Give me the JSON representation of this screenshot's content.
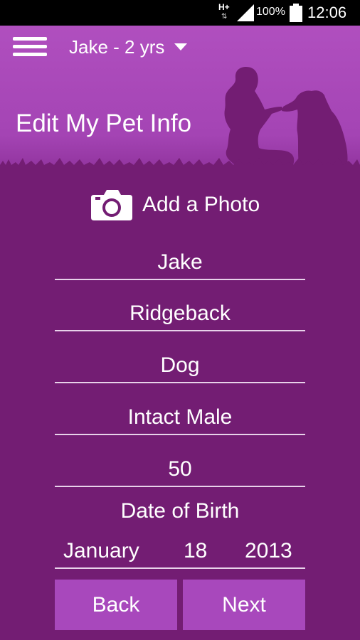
{
  "status_bar": {
    "network": "H+",
    "network_arrows": "⇅",
    "battery": "100%",
    "time": "12:06"
  },
  "header": {
    "menu_icon": "hamburger-menu-icon",
    "pet_selector": "Jake - 2 yrs",
    "title": "Edit My Pet Info"
  },
  "photo": {
    "icon": "camera-icon",
    "label": "Add a Photo"
  },
  "fields": {
    "name": "Jake",
    "breed": "Ridgeback",
    "species": "Dog",
    "sex": "Intact Male",
    "weight": "50"
  },
  "dob": {
    "label": "Date of Birth",
    "month": "January",
    "day": "18",
    "year": "2013"
  },
  "buttons": {
    "back": "Back",
    "next": "Next"
  },
  "colors": {
    "header": "#b04fbf",
    "background": "#731d73",
    "button": "#a848bc",
    "silhouette": "#731d73"
  }
}
